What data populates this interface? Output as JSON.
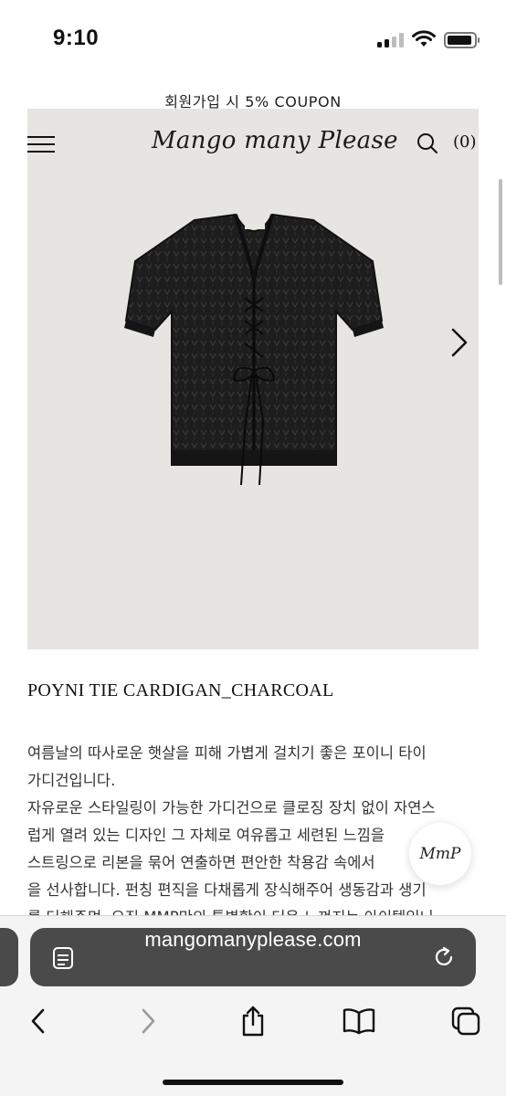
{
  "status": {
    "time": "9:10"
  },
  "banner": {
    "coupon": "회원가입 시 5% COUPON"
  },
  "header": {
    "logo": "Mango many Please",
    "cart_count": "(0)"
  },
  "product": {
    "title": "POYNI TIE CARDIGAN_CHARCOAL",
    "description_lines": [
      "여름날의 따사로운 햇살을 피해 가볍게 걸치기 좋은 포이니 타이",
      "가디건입니다.",
      "자유로운 스타일링이 가능한 가디건으로 클로징 장치 없이 자연스",
      "럽게 열려 있는 디자인 그 자체로 여유롭고 세련된 느낌을",
      "스트링으로 리본을 묶어 연출하면 편안한 착용감 속에서",
      "을 선사합니다. 펀칭 편직을 다채롭게 장식해주어 생동감과 생기",
      "를 더해주며, 오직 MMP만의 특별함이 더욱 느껴지는 아이템입니"
    ]
  },
  "chat": {
    "badge_text": "MmP"
  },
  "browser": {
    "url": "mangomanyplease.com"
  },
  "icons": {
    "menu": "hamburger-icon",
    "search": "search-icon",
    "next": "chevron-right-icon",
    "tabs_layout": "page-format-icon",
    "reload": "reload-icon",
    "back": "chevron-left-icon",
    "forward": "chevron-right-icon",
    "share": "share-icon",
    "bookmarks": "book-icon",
    "tabs": "tabs-icon"
  }
}
